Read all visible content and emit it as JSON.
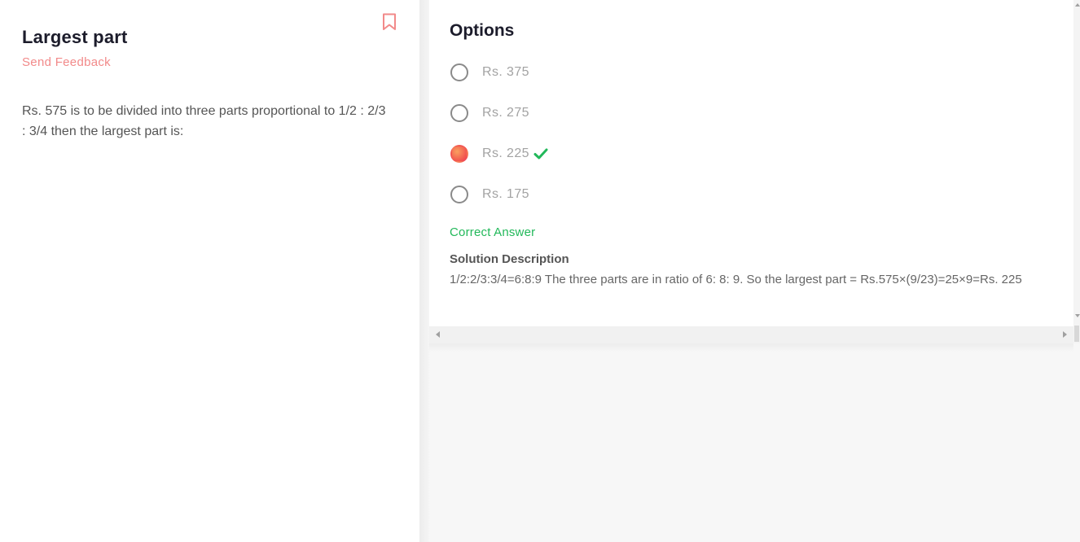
{
  "question": {
    "title": "Largest part",
    "feedback_label": "Send Feedback",
    "text": "Rs. 575 is to be divided into three parts proportional to 1/2 : 2/3 : 3/4 then the largest part is:"
  },
  "options": {
    "title": "Options",
    "items": [
      {
        "label": "Rs. 375",
        "selected": false,
        "correct": false
      },
      {
        "label": "Rs. 275",
        "selected": false,
        "correct": false
      },
      {
        "label": "Rs. 225",
        "selected": true,
        "correct": true
      },
      {
        "label": "Rs. 175",
        "selected": false,
        "correct": false
      }
    ]
  },
  "result": {
    "status": "Correct Answer",
    "solution_title": "Solution Description",
    "solution_text": "1/2:2/3:3/4=6:8:9 The three parts are in ratio of 6: 8: 9. So the largest part = Rs.575×(9/23)=25×9=Rs. 225"
  },
  "icons": {
    "bookmark": "bookmark-icon",
    "check": "check-icon"
  },
  "colors": {
    "accent": "#f28a8a",
    "correct": "#22b85a",
    "selected_gradient_start": "#f9a05f",
    "selected_gradient_end": "#ea3f5f"
  }
}
